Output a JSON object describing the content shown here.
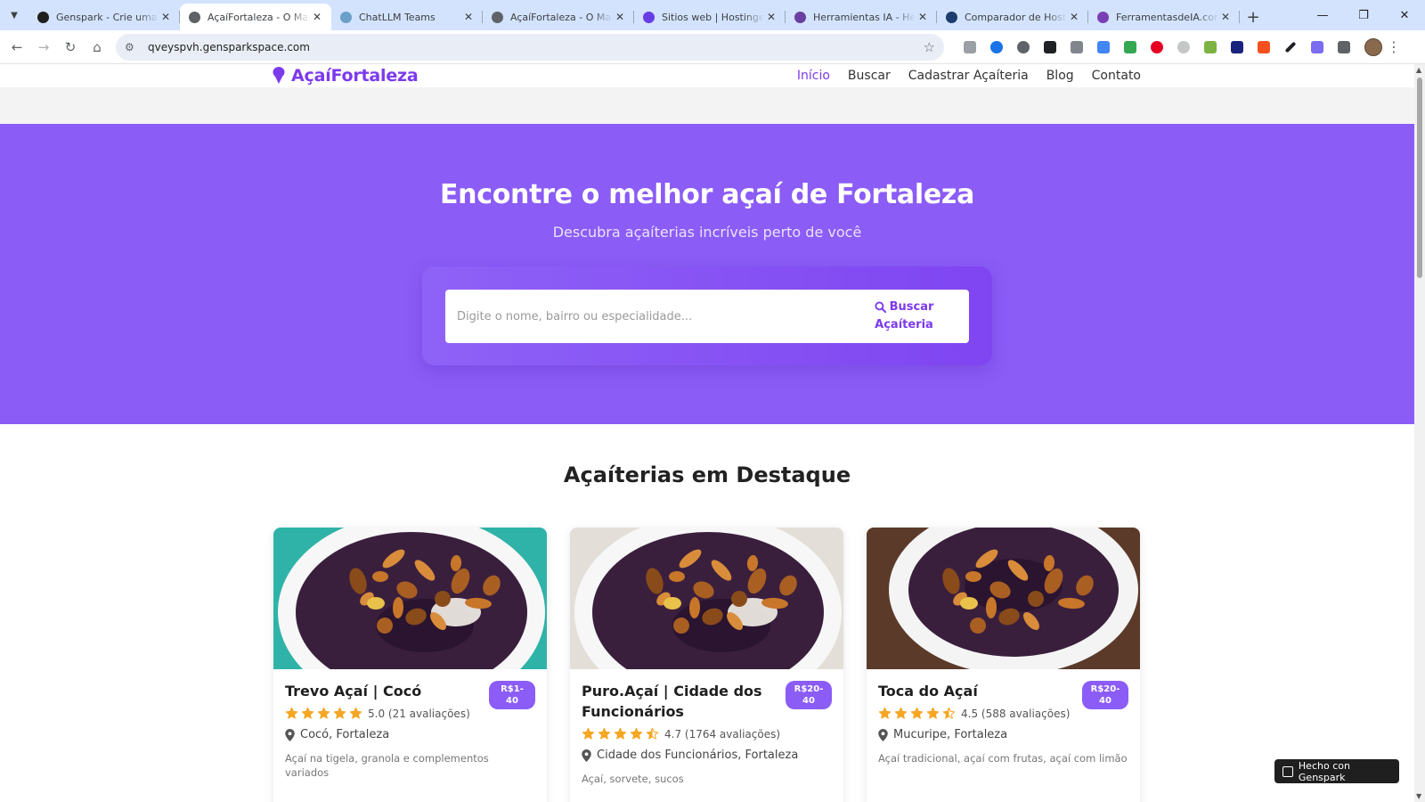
{
  "browser": {
    "tabs": [
      {
        "title": "Genspark - Crie uma aplicação",
        "favicon": "genspark-icon",
        "color": "#1f1f1f",
        "active": false
      },
      {
        "title": "AçaíFortaleza - O Maior Guia",
        "favicon": "globe-icon",
        "color": "#5f6368",
        "active": true
      },
      {
        "title": "ChatLLM Teams",
        "favicon": "chatllm-icon",
        "color": "#6aa0c8",
        "active": false
      },
      {
        "title": "AçaíFortaleza - O Maior Guia",
        "favicon": "globe-icon",
        "color": "#5f6368",
        "active": false
      },
      {
        "title": "Sitios web | Hostinger",
        "favicon": "hostinger-icon",
        "color": "#673de6",
        "active": false
      },
      {
        "title": "Herramientas IA - Herramientas",
        "favicon": "ia-icon",
        "color": "#6b3fa0",
        "active": false
      },
      {
        "title": "Comparador de Hosting | ",
        "favicon": "monitor-icon",
        "color": "#1c3d6e",
        "active": false
      },
      {
        "title": "FerramentasdeIA.com - A",
        "favicon": "ferramentas-icon",
        "color": "#7b3fb5",
        "active": false
      }
    ],
    "url": "qveyspvh.gensparkspace.com"
  },
  "site": {
    "brand": "AçaíFortaleza",
    "nav": [
      {
        "label": "Início",
        "active": true
      },
      {
        "label": "Buscar",
        "active": false
      },
      {
        "label": "Cadastrar Açaíteria",
        "active": false
      },
      {
        "label": "Blog",
        "active": false
      },
      {
        "label": "Contato",
        "active": false
      }
    ]
  },
  "hero": {
    "title": "Encontre o melhor açaí de Fortaleza",
    "subtitle": "Descubra açaíterias incríveis perto de você",
    "search_placeholder": "Digite o nome, bairro ou especialidade...",
    "search_button_line1": "Buscar",
    "search_button_line2": "Açaíteria"
  },
  "featured": {
    "title": "Açaíterias em Destaque",
    "cards": [
      {
        "name": "Trevo Açaí | Cocó",
        "price": "R$1-40",
        "stars": 5.0,
        "rating": "5.0 (21 avaliações)",
        "location": "Cocó, Fortaleza",
        "desc": "Açaí na tigela, granola e complementos variados"
      },
      {
        "name": "Puro.Açaí | Cidade dos Funcionários",
        "price": "R$20-40",
        "stars": 4.7,
        "rating": "4.7 (1764 avaliações)",
        "location": "Cidade dos Funcionários, Fortaleza",
        "desc": "Açaí, sorvete, sucos"
      },
      {
        "name": "Toca do Açaí",
        "price": "R$20-40",
        "stars": 4.5,
        "rating": "4.5 (588 avaliações)",
        "location": "Mucuripe, Fortaleza",
        "desc": "Açaí tradicional, açaí com frutas, açaí com limão"
      }
    ]
  },
  "badge": {
    "label": "Hecho con Genspark"
  },
  "colors": {
    "accent": "#7c3aed",
    "hero": "#8b5cf6",
    "star": "#f5a623"
  }
}
